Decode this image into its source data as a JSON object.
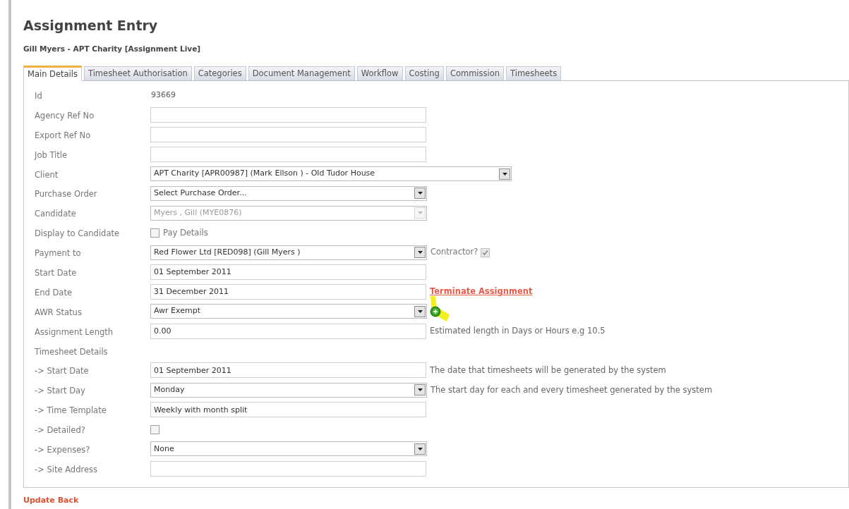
{
  "title": "Assignment Entry",
  "subtitle": "Gill Myers - APT Charity [Assignment Live]",
  "tabs": [
    {
      "label": "Main Details",
      "selected": true
    },
    {
      "label": "Timesheet Authorisation",
      "selected": false
    },
    {
      "label": "Categories",
      "selected": false
    },
    {
      "label": "Document Management",
      "selected": false
    },
    {
      "label": "Workflow",
      "selected": false
    },
    {
      "label": "Costing",
      "selected": false
    },
    {
      "label": "Commission",
      "selected": false
    },
    {
      "label": "Timesheets",
      "selected": false
    }
  ],
  "rows": [
    {
      "label": "Id",
      "kind": "text",
      "value": "93669"
    },
    {
      "label": "Agency Ref No",
      "kind": "input"
    },
    {
      "label": "Export Ref No",
      "kind": "input"
    },
    {
      "label": "Job Title",
      "kind": "input"
    },
    {
      "label": "Client",
      "kind": "select",
      "value": "APT Charity [APR00987] (Mark Ellson ) - Old Tudor House",
      "disabled": false,
      "wide": true
    },
    {
      "label": "Purchase Order",
      "kind": "select",
      "value": "Select Purchase Order...",
      "disabled": false
    },
    {
      "label": "Candidate",
      "kind": "select",
      "value": "Myers , Gill (MYE0876)",
      "disabled": true
    },
    {
      "label": "Display to Candidate",
      "kind": "checkbox",
      "checked": false,
      "option": "Pay Details"
    },
    {
      "label": "Payment to",
      "kind": "select",
      "value": "Red Flower Ltd [RED098] (Gill Myers )",
      "disabled": false,
      "extra": {
        "kind": "checkbox",
        "label": "Contractor?",
        "checked": true,
        "disabled": true
      }
    },
    {
      "label": "Start Date",
      "kind": "input",
      "value": "01 September 2011"
    },
    {
      "label": "End Date",
      "kind": "input",
      "value": "31 December 2011",
      "extra": {
        "kind": "link",
        "label": "Terminate Assignment"
      }
    },
    {
      "label": "AWR Status",
      "kind": "select",
      "value": "Awr Exempt",
      "disabled": false,
      "extra": {
        "kind": "icon"
      }
    },
    {
      "label": "Assignment Length",
      "kind": "input",
      "value": "0.00",
      "extra": {
        "kind": "note",
        "label": "Estimated length in Days or Hours e.g 10.5"
      }
    },
    {
      "label": "Timesheet Details",
      "kind": "heading"
    },
    {
      "label": "-> Start Date",
      "kind": "input",
      "value": "01 September 2011",
      "extra": {
        "kind": "note",
        "label": "The date that timesheets will be generated by the system"
      }
    },
    {
      "label": "-> Start Day",
      "kind": "select",
      "value": "Monday",
      "disabled": false,
      "extra": {
        "kind": "note",
        "label": "The start day for each and every timesheet generated by the system"
      }
    },
    {
      "label": "-> Time Template",
      "kind": "input",
      "value": "Weekly with month split"
    },
    {
      "label": "-> Detailed?",
      "kind": "checkbox",
      "checked": false
    },
    {
      "label": "-> Expenses?",
      "kind": "select",
      "value": "None",
      "disabled": false
    },
    {
      "label": "-> Site Address",
      "kind": "input"
    }
  ],
  "footer_link": "Update Back"
}
